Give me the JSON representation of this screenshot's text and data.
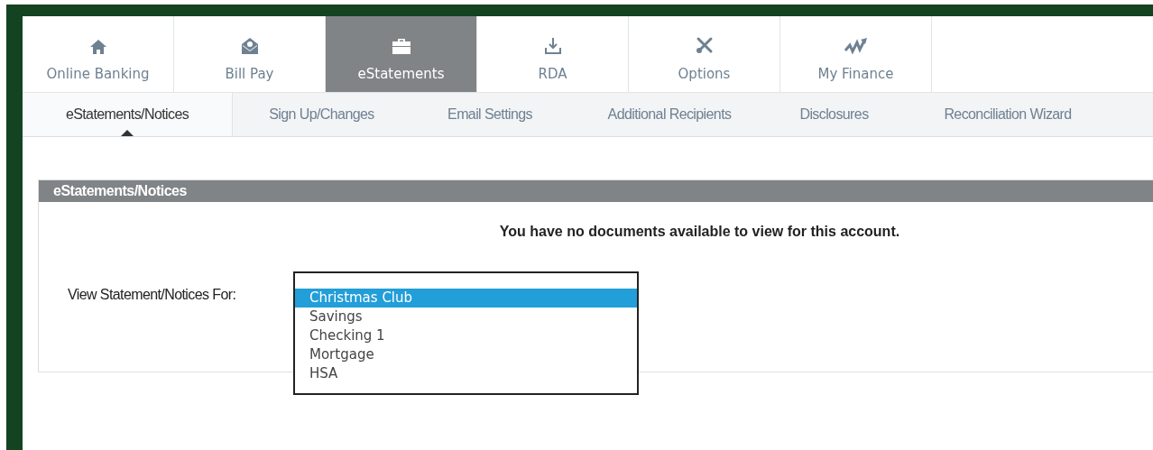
{
  "main_tabs": [
    {
      "label": "Online Banking",
      "selected": false
    },
    {
      "label": "Bill Pay",
      "selected": false
    },
    {
      "label": "eStatements",
      "selected": true
    },
    {
      "label": "RDA",
      "selected": false
    },
    {
      "label": "Options",
      "selected": false
    },
    {
      "label": "My Finance",
      "selected": false
    }
  ],
  "sub_tabs": [
    {
      "label": "eStatements/Notices",
      "selected": true
    },
    {
      "label": "Sign Up/Changes",
      "selected": false
    },
    {
      "label": "Email Settings",
      "selected": false
    },
    {
      "label": "Additional Recipients",
      "selected": false
    },
    {
      "label": "Disclosures",
      "selected": false
    },
    {
      "label": "Reconciliation Wizard",
      "selected": false
    }
  ],
  "panel": {
    "title": "eStatements/Notices",
    "message": "You have no documents available to view for this account.",
    "field_label": "View Statement/Notices For:",
    "options": [
      {
        "label": "Christmas Club",
        "selected": true
      },
      {
        "label": "Savings",
        "selected": false
      },
      {
        "label": "Checking 1",
        "selected": false
      },
      {
        "label": "Mortgage",
        "selected": false
      },
      {
        "label": "HSA",
        "selected": false
      }
    ]
  }
}
